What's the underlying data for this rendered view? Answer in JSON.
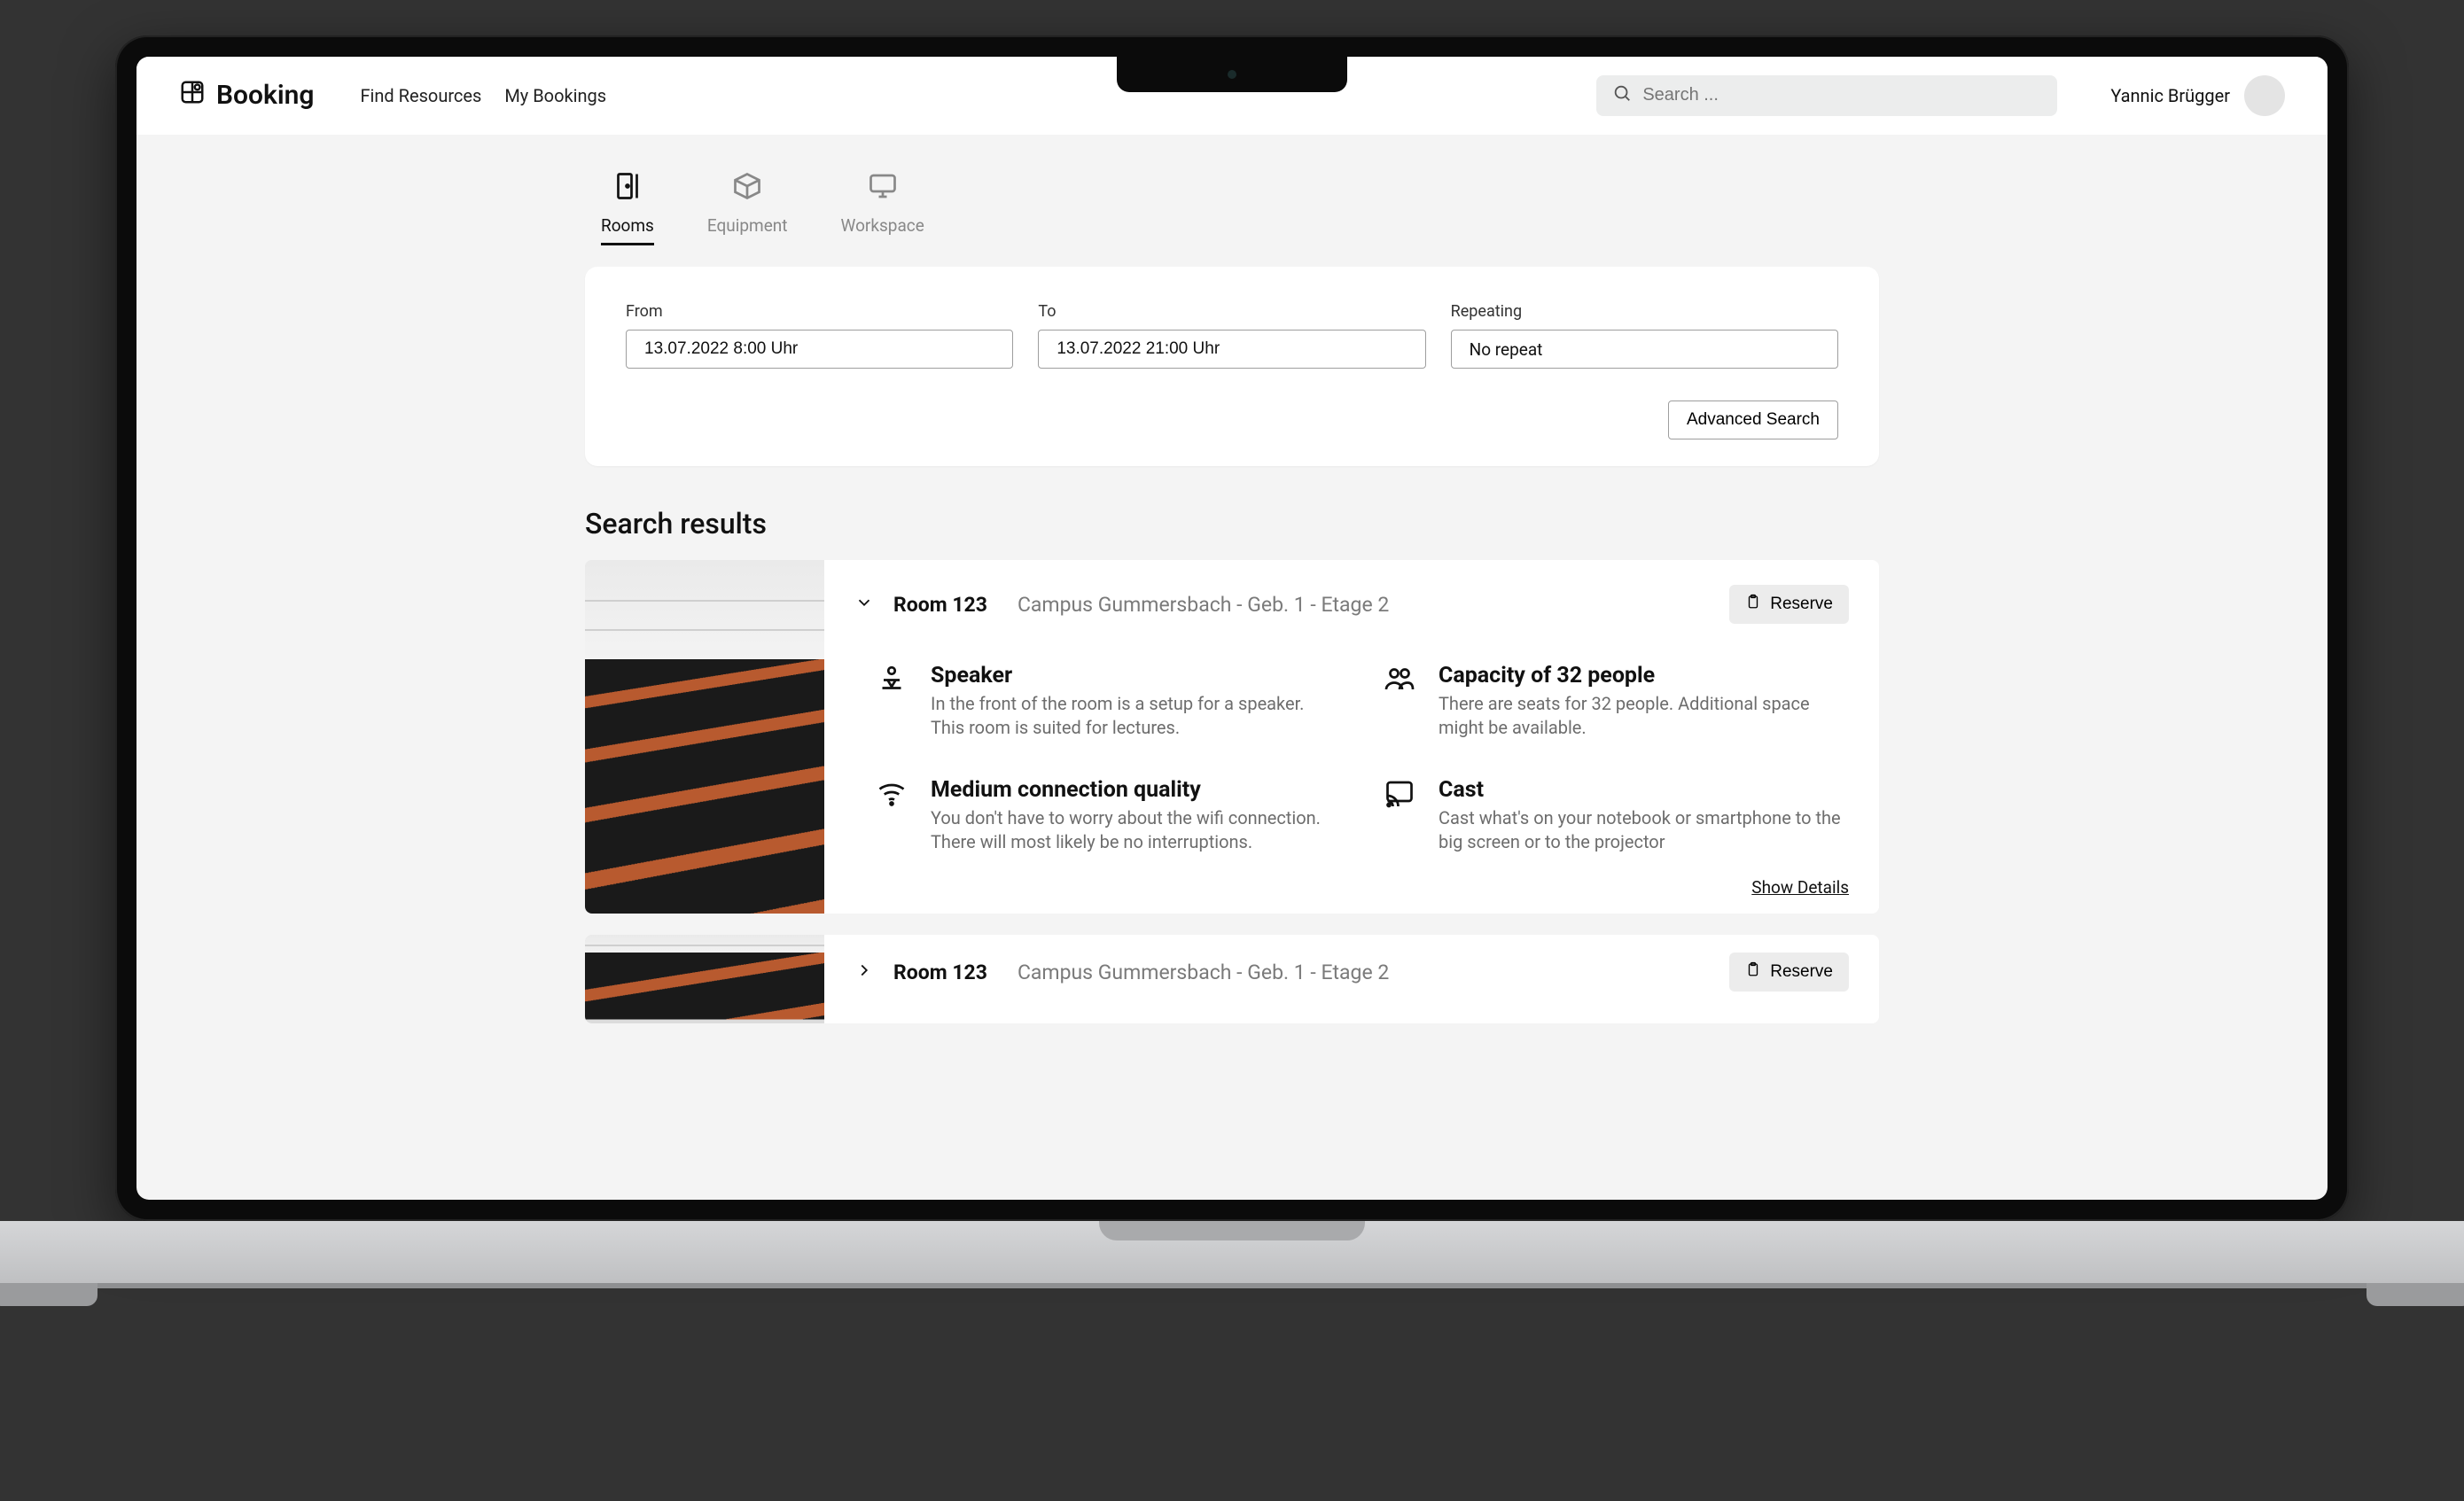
{
  "brand": "Booking",
  "nav": {
    "find": "Find Resources",
    "mine": "My Bookings"
  },
  "search_placeholder": "Search ...",
  "user_name": "Yannic Brügger",
  "tabs": {
    "rooms": "Rooms",
    "equipment": "Equipment",
    "workspace": "Workspace"
  },
  "filters": {
    "from_label": "From",
    "from_value": "13.07.2022 8:00 Uhr",
    "to_label": "To",
    "to_value": "13.07.2022 21:00 Uhr",
    "repeat_label": "Repeating",
    "repeat_value": "No repeat",
    "advanced": "Advanced Search"
  },
  "results_heading": "Search results",
  "reserve_label": "Reserve",
  "show_details": "Show Details",
  "rooms": [
    {
      "name": "Room 123",
      "location": "Campus Gummersbach - Geb. 1 - Etage 2",
      "expanded": true,
      "features": [
        {
          "icon": "speaker",
          "title": "Speaker",
          "desc": "In the front of the room is a setup for a speaker. This room is suited for lectures."
        },
        {
          "icon": "people",
          "title": "Capacity of 32 people",
          "desc": "There are seats for 32 people. Additional space might be available."
        },
        {
          "icon": "wifi",
          "title": "Medium connection quality",
          "desc": "You don't have to worry about the wifi connection. There will most likely be no interruptions."
        },
        {
          "icon": "cast",
          "title": "Cast",
          "desc": "Cast what's on your notebook or smartphone to the big screen or to the projector"
        }
      ]
    },
    {
      "name": "Room 123",
      "location": "Campus Gummersbach - Geb. 1 - Etage 2",
      "expanded": false,
      "features": []
    }
  ]
}
